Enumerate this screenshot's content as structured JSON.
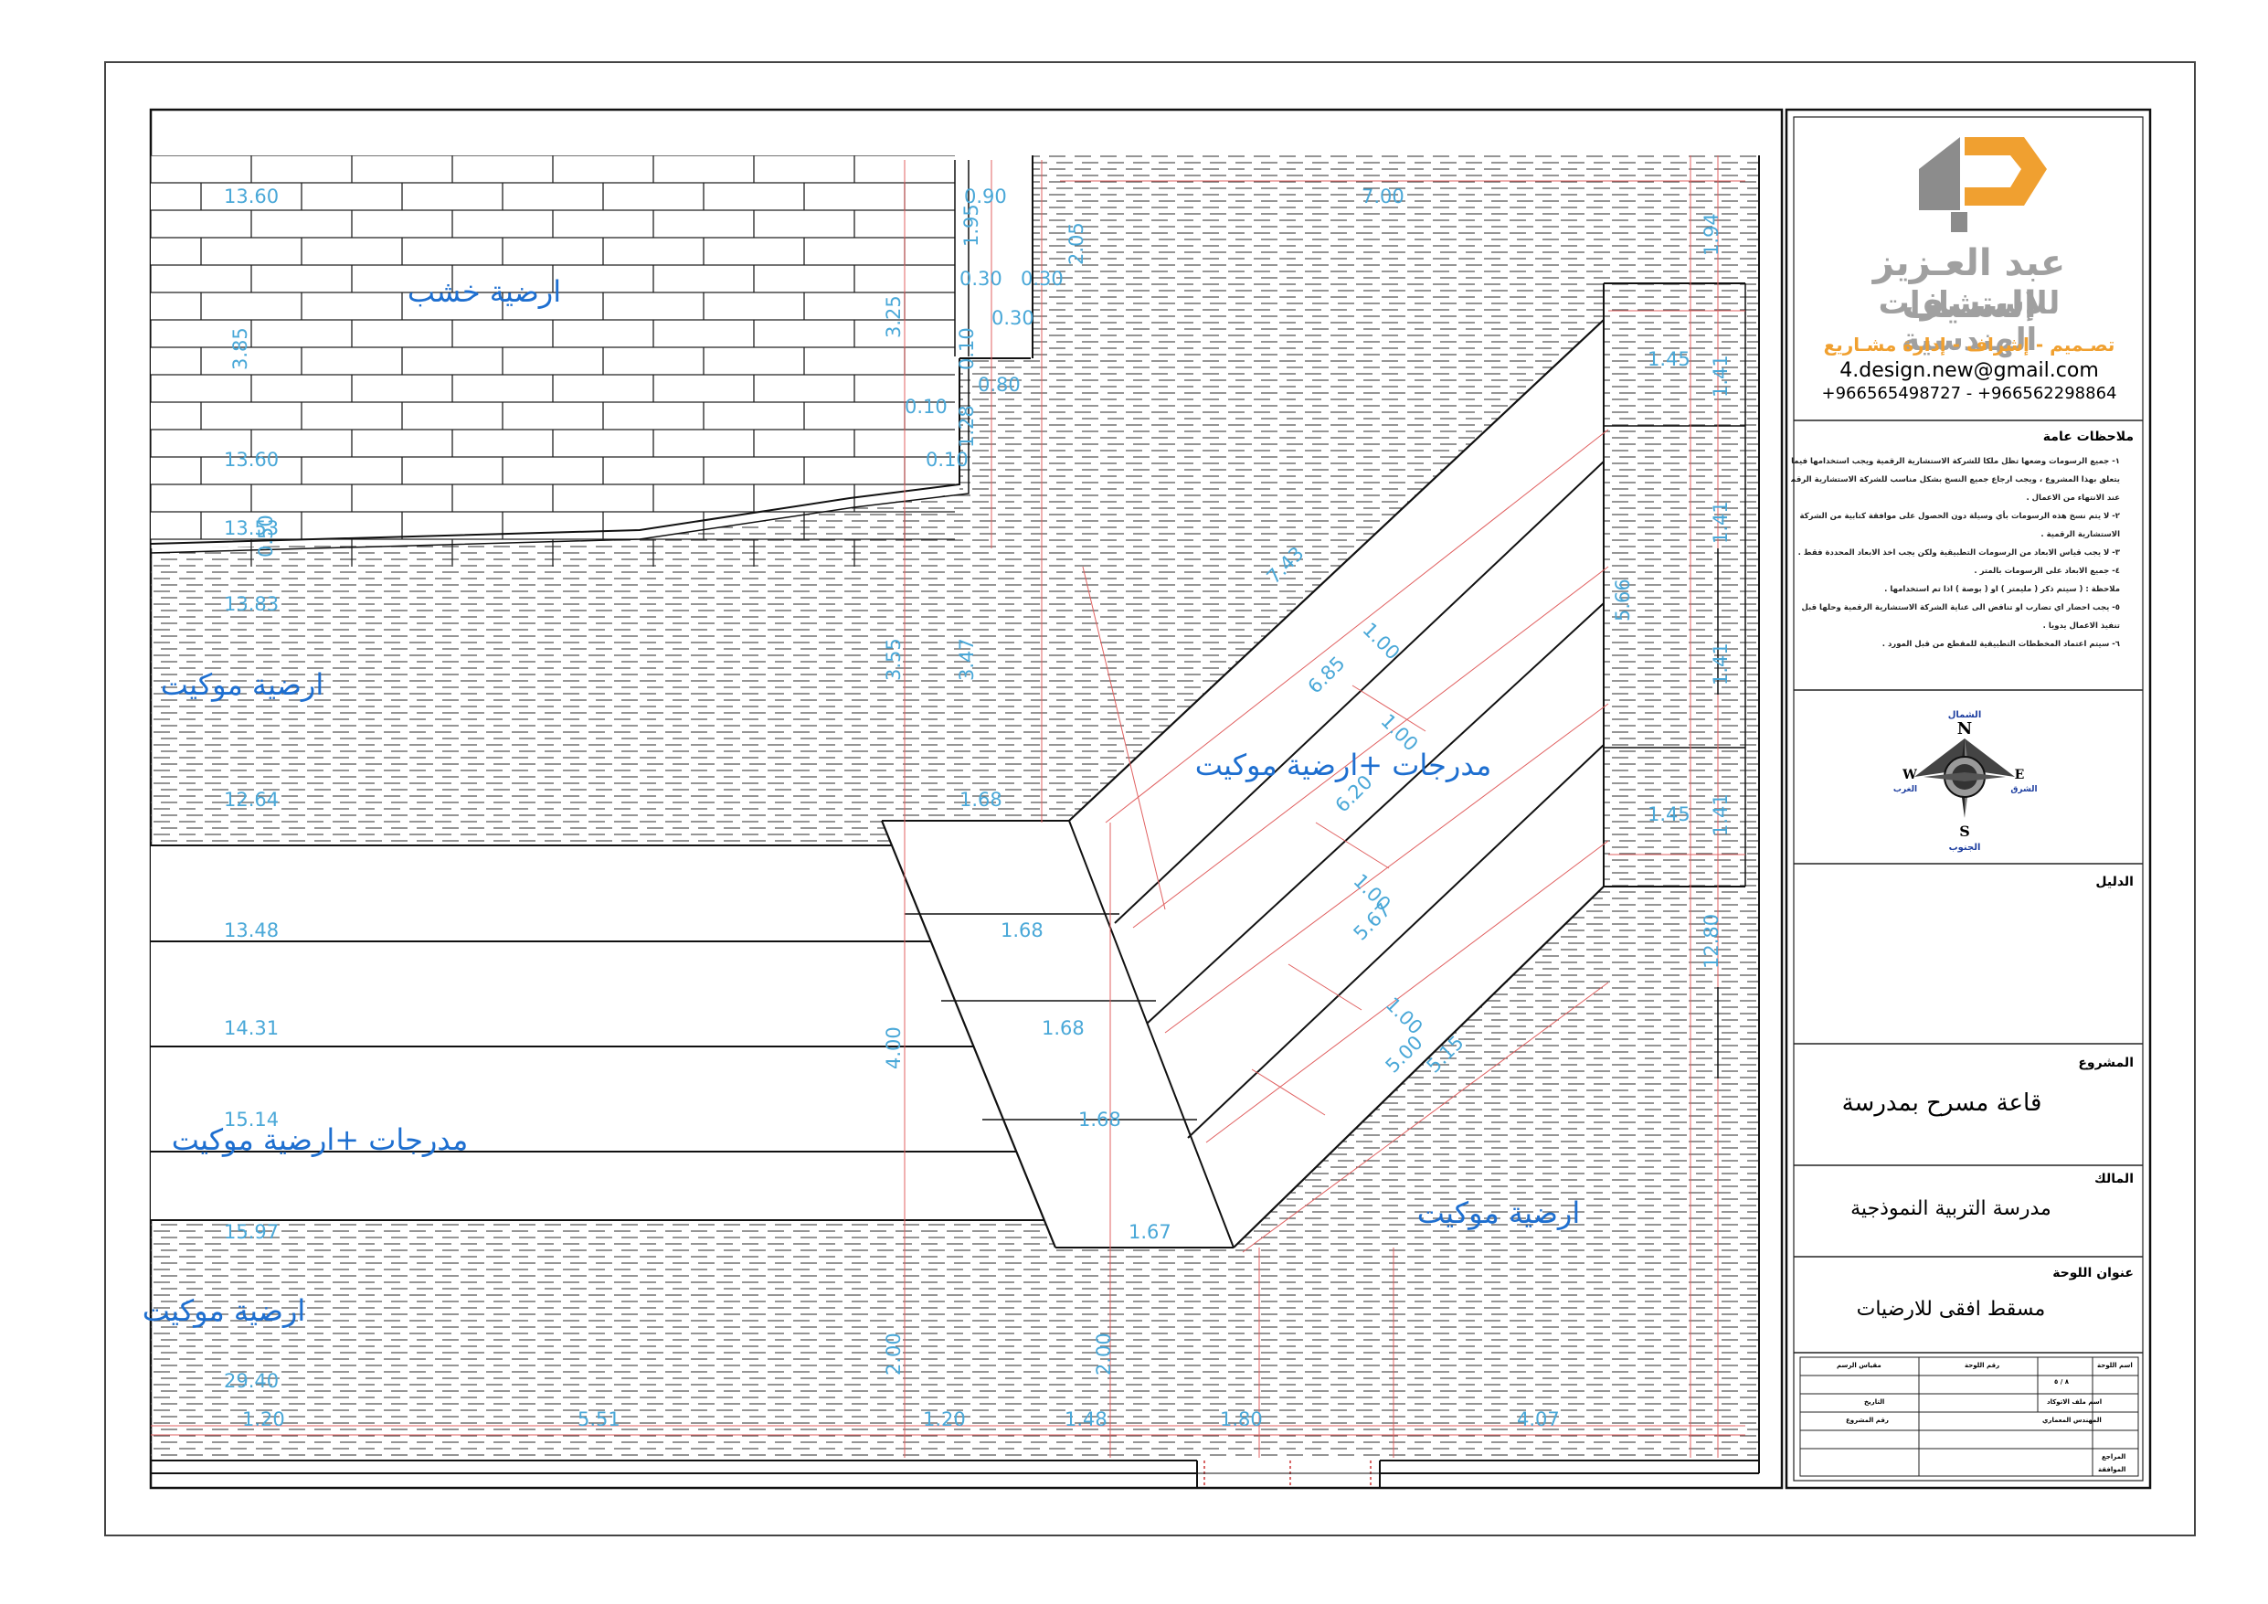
{
  "company": {
    "logo_mark": "4D",
    "name_line1": "عبد العـزيز السـيف",
    "name_line2": "للإستشارات الهندسية",
    "services": "تصـميم - إشراف - إدارة مشـاريع",
    "email": "4.design.new@gmail.com",
    "phones": "+966565498727 - +966562298864",
    "colors": {
      "logo_gray": "#8c8c8c",
      "logo_orange": "#f0a030",
      "text_gray": "#a0a0a0"
    }
  },
  "notes": {
    "title": "ملاحظات عامة",
    "lines": [
      "١- جميع الرسومات وضعها تظل ملكا للشركة الاستشارية الرقمية ويجب استخدامها فيما",
      "يتعلق بهذا المشروع ، ويجب ارجاع جميع النسخ بشكل مناسب للشركة الاستشارية الرقمية",
      "عند الانتهاء من الاعمال .",
      "٢- لا يتم نسخ هذه الرسومات بأي وسيلة دون الحصول على موافقة كتابية من الشركة",
      "الاستشارية الرقمية .",
      "٣- لا يجب قياس الابعاد من الرسومات التطبيقية ولكن يجب اخذ الابعاد المحددة فقط .",
      "٤- جميع الابعاد على الرسومات بالمتر .",
      "ملاحظة : ( سيتم ذكر ( مليمتر ) او ( بوصة ) اذا تم استخدامها .",
      "٥- يجب احضار اي تضارب او تناقض الى عناية الشركة الاستشارية الرقمية وحلها قبل",
      "تنفيذ الاعمال يدويا .",
      "٦- سيتم اعتماد المخططات التطبيقية للمقطع من قبل المورد ."
    ]
  },
  "compass": {
    "n": "N",
    "s": "S",
    "e": "E",
    "w": "W",
    "ar_n": "الشمال",
    "ar_s": "الجنوب",
    "ar_e": "الشرق",
    "ar_w": "الغرب"
  },
  "legend": {
    "label": "الدليل"
  },
  "project": {
    "label": "المشروع",
    "value": "قاعة مسرح بمدرسة"
  },
  "owner": {
    "label": "المالك",
    "value": "مدرسة التربية النموذجية"
  },
  "sheet_title": {
    "label": "عنوان اللوحة",
    "value": "مسقط افقى للارضيات"
  },
  "title_block_cells": {
    "scale": "مقياس الرسم",
    "sheet_no": "رقم اللوحة",
    "drawn": "اسم اللوحة",
    "sheet_value": "٨ / ٥",
    "file": "اسم ملف الاتوكاد",
    "date": "التاريخ",
    "architect": "المهندس المعماري",
    "project_no": "رقم المشروع",
    "reviewed": "المراجع",
    "approved": "الموافقة"
  },
  "floor_labels": {
    "wood": "ارضية خشب",
    "carpet_left": "ارضية موكيت",
    "steps_center": "مدرجات +ارضية موكيت",
    "steps_left": "مدرجات +ارضية موكيت",
    "carpet_right": "ارضية موكيت",
    "carpet_bottom_left": "ارضية موكيت"
  },
  "dimensions": {
    "d_1360_top": "13.60",
    "d_090": "0.90",
    "d_700": "7.00",
    "d_194": "1.94",
    "d_195": "1.95",
    "d_030a": "0.30",
    "d_030b": "0.30",
    "d_205": "2.05",
    "d_030c": "0.30",
    "d_325": "3.25",
    "d_385": "3.85",
    "d_010a": "0.10",
    "d_080": "0.80",
    "d_010b": "0.10",
    "d_128": "1.28",
    "d_1360_mid": "13.60",
    "d_010c": "0.10",
    "d_1353": "13.53",
    "d_050": "0.50",
    "d_1383": "13.83",
    "d_145a": "1.45",
    "d_141a": "1.41",
    "d_743": "7.43",
    "d_100a": "1.00",
    "d_141b": "1.41",
    "d_566": "5.66",
    "d_355": "3.55",
    "d_347": "3.47",
    "d_685": "6.85",
    "d_100b": "1.00",
    "d_141c": "1.41",
    "d_620": "6.20",
    "d_1264": "12.64",
    "d_168a": "1.68",
    "d_145b": "1.45",
    "d_141d": "1.41",
    "d_1348": "13.48",
    "d_168b": "1.68",
    "d_100c": "1.00",
    "d_567": "5.67",
    "d_1280": "12.80",
    "d_1431": "14.31",
    "d_168c": "1.68",
    "d_100d": "1.00",
    "d_400": "4.00",
    "d_500": "5.00",
    "d_515": "5.15",
    "d_1514": "15.14",
    "d_168d": "1.68",
    "d_1597": "15.97",
    "d_167": "1.67",
    "d_200a": "2.00",
    "d_200b": "2.00",
    "d_2940": "29.40",
    "d_120a": "1.20",
    "d_551": "5.51",
    "d_120b": "1.20",
    "d_148": "1.48",
    "d_180": "1.80",
    "d_407": "4.07"
  }
}
